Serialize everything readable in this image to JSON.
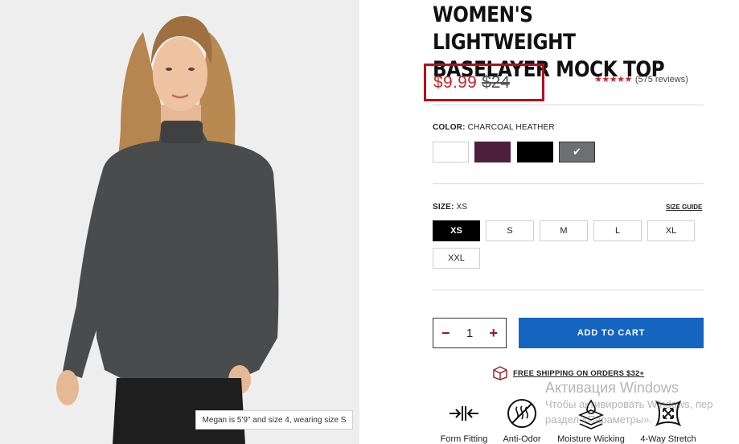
{
  "product": {
    "title_line1": "WOMEN'S LIGHTWEIGHT",
    "title_line2": "BASELAYER MOCK TOP",
    "price_sale": "$9.99",
    "price_original": "$24",
    "stars": "★★★★★",
    "reviews": "(575 reviews)",
    "rating_color": "#c1272d"
  },
  "image": {
    "caption": "Megan is 5'9\" and size 4, wearing size S"
  },
  "color": {
    "label_prefix": "COLOR:",
    "selected_value": "CHARCOAL HEATHER",
    "swatches": [
      {
        "name": "white",
        "hex": "#ffffff"
      },
      {
        "name": "plum",
        "hex": "#4e1f3c"
      },
      {
        "name": "black",
        "hex": "#000000"
      },
      {
        "name": "charcoal heather",
        "hex": "#6d6f72",
        "selected": true
      }
    ],
    "check_glyph": "✔"
  },
  "size": {
    "label_prefix": "SIZE:",
    "selected_value": "XS",
    "guide_label": "SIZE GUIDE",
    "options": [
      "XS",
      "S",
      "M",
      "L",
      "XL",
      "XXL"
    ]
  },
  "quantity": {
    "minus": "−",
    "value": "1",
    "plus": "+"
  },
  "cart": {
    "add_label": "ADD TO CART",
    "button_color": "#1565c0"
  },
  "shipping": {
    "label": "FREE SHIPPING ON ORDERS $32+"
  },
  "features": [
    {
      "label": "Form Fitting",
      "icon": "form-fitting-icon"
    },
    {
      "label": "Anti-Odor",
      "icon": "anti-odor-icon"
    },
    {
      "label": "Moisture Wicking",
      "icon": "moisture-wicking-icon"
    },
    {
      "label": "4-Way Stretch",
      "icon": "four-way-stretch-icon"
    }
  ],
  "os_watermark": {
    "title": "Активация Windows",
    "line1": "Чтобы активировать Windows, пер",
    "line2": "раздел «Параметры»."
  }
}
